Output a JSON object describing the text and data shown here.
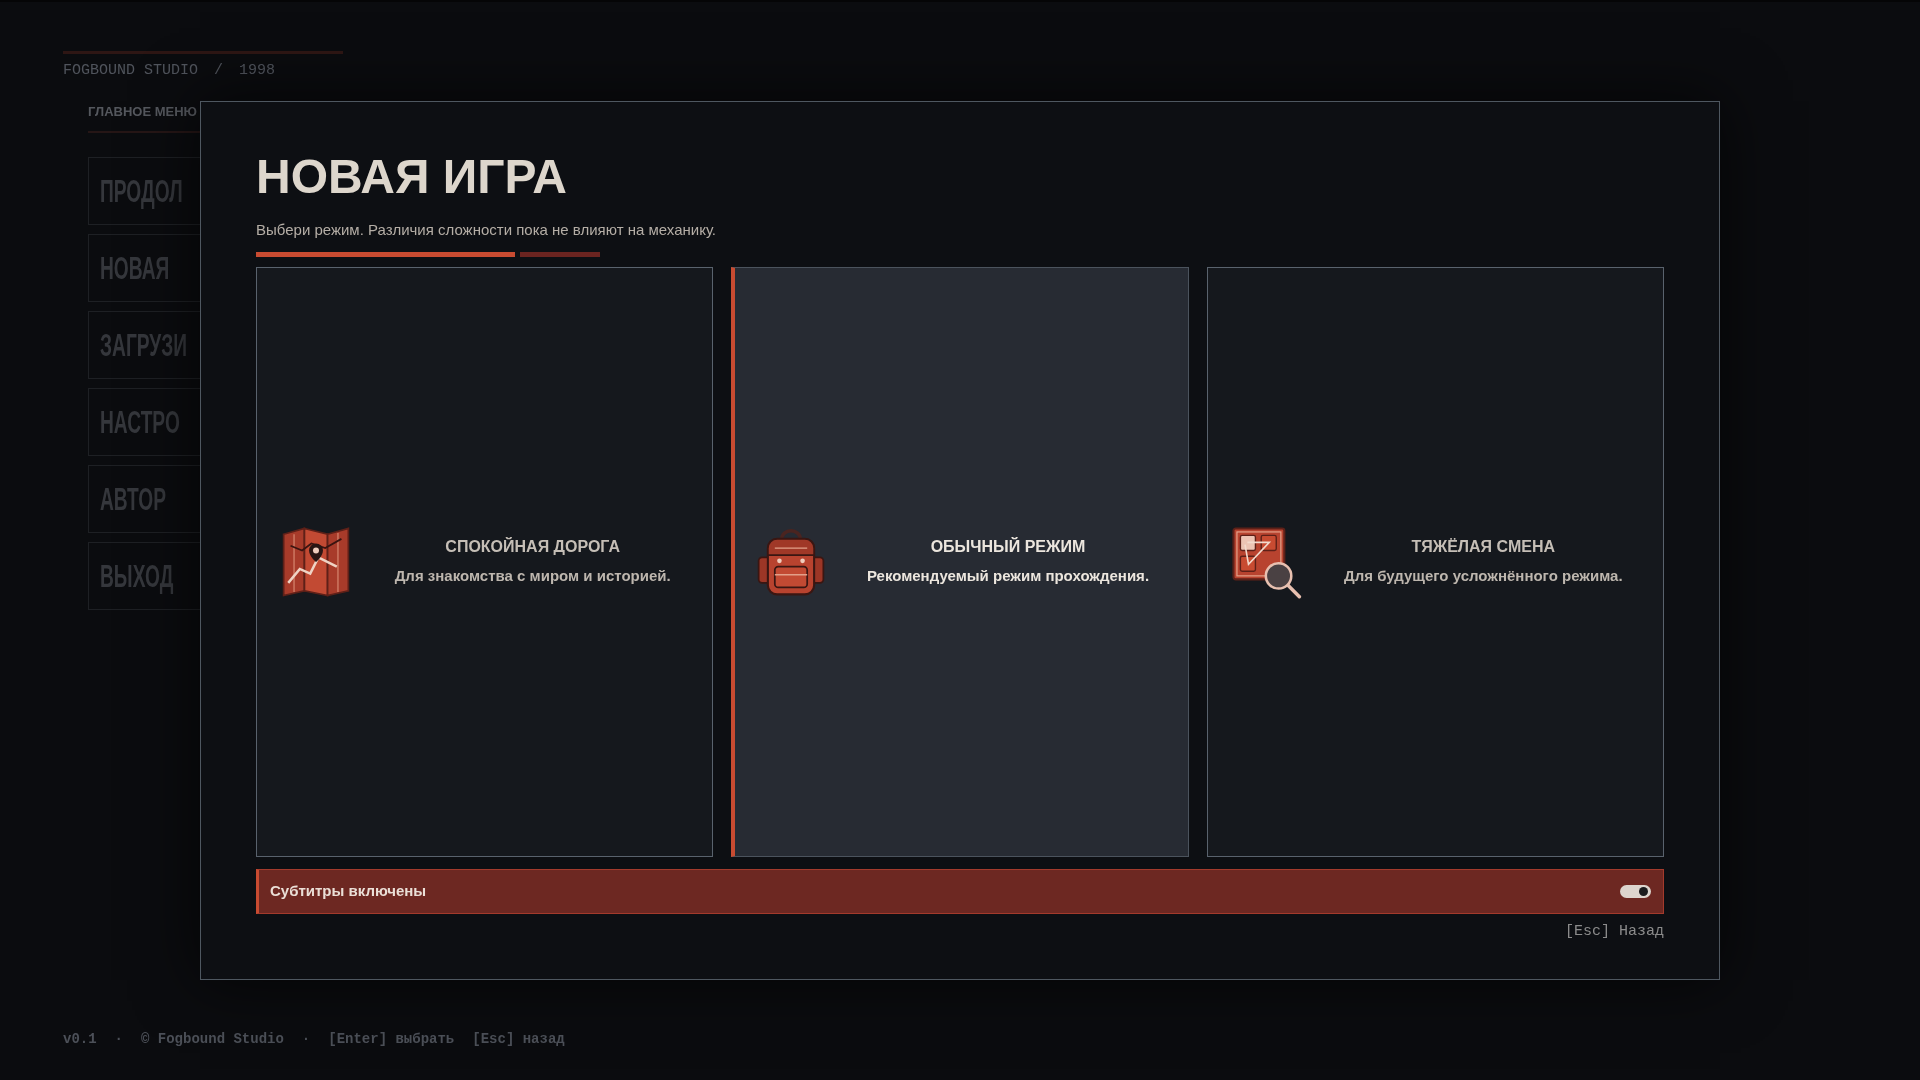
{
  "background_menu": {
    "studio_line": {
      "brand": "FOGBOUND STUDIO",
      "separator": "/",
      "year": "1998"
    },
    "menu_title": "ГЛАВНОЕ МЕНЮ",
    "menu_items": [
      "ПРОДОЛ",
      "НОВАЯ",
      "ЗАГРУЗИ",
      "НАСТРО",
      "АВТОР",
      "ВЫХОД"
    ]
  },
  "dialog": {
    "title": "НОВАЯ ИГРА",
    "subtitle": "Выбери режим. Различия сложности пока не влияют на механику.",
    "modes": [
      {
        "title": "СПОКОЙНАЯ ДОРОГА",
        "description": "Для знакомства с миром и историей.",
        "selected": false
      },
      {
        "title": "ОБЫЧНЫЙ РЕЖИМ",
        "description": "Рекомендуемый режим прохождения.",
        "selected": true
      },
      {
        "title": "ТЯЖЁЛАЯ СМЕНА",
        "description": "Для будущего усложнённого режима.",
        "selected": false
      }
    ],
    "subtitles_toggle": {
      "label": "Субтитры включены",
      "on": true
    },
    "back_hint": "[Esc] Назад"
  },
  "footer": [
    "v0.1",
    "·",
    "© Fogbound Studio",
    "·",
    "[Enter] выбрать",
    "[Esc] назад"
  ]
}
